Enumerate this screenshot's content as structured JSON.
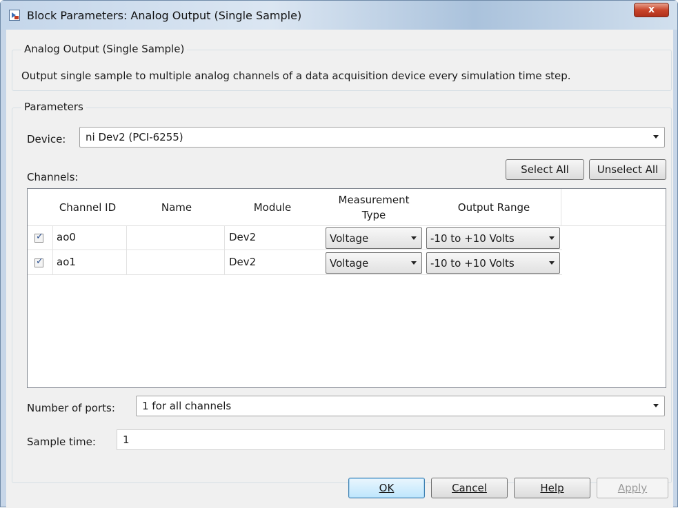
{
  "window": {
    "title": "Block Parameters: Analog Output (Single Sample)",
    "close_label": "x"
  },
  "description_group": {
    "legend": "Analog Output (Single Sample)",
    "text": "Output single sample to multiple analog channels of a data acquisition device every simulation time step."
  },
  "parameters": {
    "legend": "Parameters",
    "device_label": "Device:",
    "device_value": "ni Dev2 (PCI-6255)",
    "channels_label": "Channels:",
    "select_all_label": "Select All",
    "unselect_all_label": "Unselect All",
    "ports_label": "Number of ports:",
    "ports_value": "1 for all channels",
    "sample_time_label": "Sample time:",
    "sample_time_value": "1"
  },
  "table": {
    "columns": [
      "Channel ID",
      "Name",
      "Module",
      "Measurement Type",
      "Output Range"
    ],
    "rows": [
      {
        "checked": true,
        "channel_id": "ao0",
        "name": "",
        "module": "Dev2",
        "measurement_type": "Voltage",
        "output_range": "-10 to +10 Volts"
      },
      {
        "checked": true,
        "channel_id": "ao1",
        "name": "",
        "module": "Dev2",
        "measurement_type": "Voltage",
        "output_range": "-10 to +10 Volts"
      }
    ]
  },
  "footer": {
    "ok_label": "OK",
    "cancel_label": "Cancel",
    "help_label": "Help",
    "apply_label": "Apply"
  },
  "colors": {
    "close_button": "#c8452b",
    "default_button": "#bee6fd",
    "dialog_background": "#f0f0f0"
  }
}
